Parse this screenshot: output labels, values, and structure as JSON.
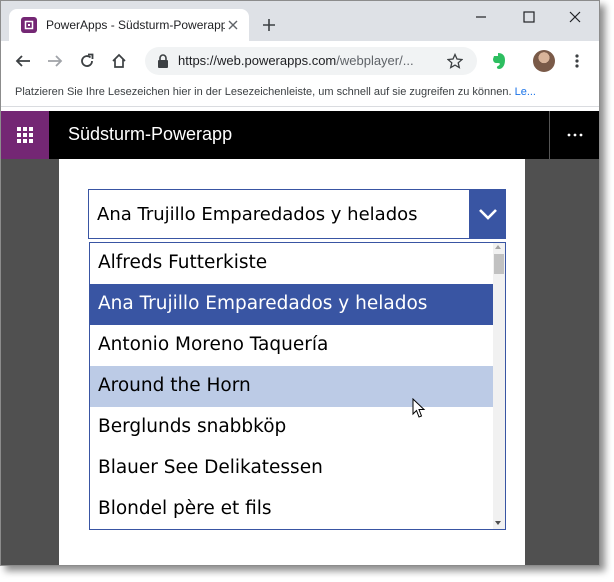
{
  "browser": {
    "tab_title": "PowerApps - Südsturm-Powerapp",
    "url_domain": "https://web.powerapps.com",
    "url_path": "/webplayer/...",
    "bookmarks_hint": "Platzieren Sie Ihre Lesezeichen hier in der Lesezeichenleiste, um schnell auf sie zugreifen zu können.",
    "bookmarks_link": "Le..."
  },
  "app": {
    "title": "Südsturm-Powerapp",
    "dropdown_value": "Ana Trujillo Emparedados y helados",
    "items": [
      {
        "label": "Alfreds Futterkiste",
        "state": "normal"
      },
      {
        "label": "Ana Trujillo Emparedados y helados",
        "state": "selected"
      },
      {
        "label": "Antonio Moreno Taquería",
        "state": "normal"
      },
      {
        "label": "Around the Horn",
        "state": "hover"
      },
      {
        "label": "Berglunds snabbköp",
        "state": "normal"
      },
      {
        "label": "Blauer See Delikatessen",
        "state": "normal"
      },
      {
        "label": "Blondel père et fils",
        "state": "normal"
      }
    ]
  },
  "colors": {
    "app_accent": "#742774",
    "dropdown_accent": "#3955a3",
    "hover": "#bccbe6",
    "canvas_background": "#505050"
  },
  "icons": [
    "powerapps-favicon",
    "close-tab-icon",
    "new-tab-icon",
    "minimize-icon",
    "maximize-icon",
    "close-window-icon",
    "back-icon",
    "forward-icon",
    "reload-icon",
    "home-icon",
    "lock-icon",
    "star-icon",
    "evernote-icon",
    "avatar",
    "more-vert-icon",
    "waffle-icon",
    "more-horiz-icon",
    "chevron-down-icon",
    "mouse-cursor"
  ]
}
